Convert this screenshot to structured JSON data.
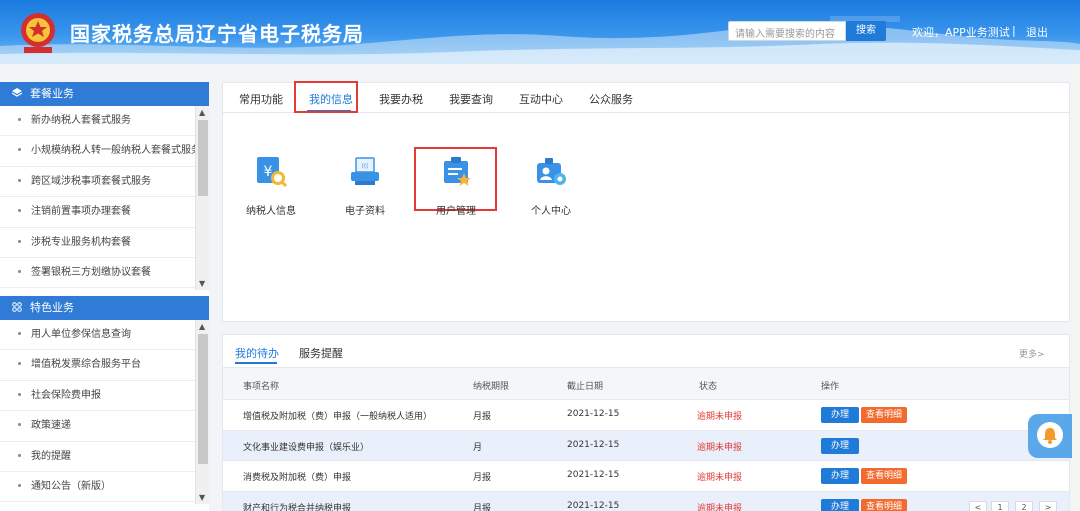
{
  "header": {
    "site_title": "国家税务总局辽宁省电子税务局",
    "search_placeholder": "请输入需要搜索的内容",
    "search_button": "搜索",
    "welcome": "欢迎，APP业务测试",
    "separator": "|",
    "logout": "退出"
  },
  "sidebar": {
    "package_title": "套餐业务",
    "package_items": [
      {
        "label": "新办纳税人套餐式服务"
      },
      {
        "label": "小规模纳税人转一般纳税人套餐式服务"
      },
      {
        "label": "跨区域涉税事项套餐式服务"
      },
      {
        "label": "注销前置事项办理套餐"
      },
      {
        "label": "涉税专业服务机构套餐"
      },
      {
        "label": "签署银税三方划缴协议套餐"
      }
    ],
    "special_title": "特色业务",
    "special_items": [
      {
        "label": "用人单位参保信息查询"
      },
      {
        "label": "增值税发票综合服务平台"
      },
      {
        "label": "社会保险费申报"
      },
      {
        "label": "政策速递"
      },
      {
        "label": "我的提醒"
      },
      {
        "label": "通知公告（新版）"
      }
    ]
  },
  "main_tabs": [
    {
      "label": "常用功能"
    },
    {
      "label": "我的信息"
    },
    {
      "label": "我要办税"
    },
    {
      "label": "我要查询"
    },
    {
      "label": "互动中心"
    },
    {
      "label": "公众服务"
    }
  ],
  "active_tab": "我的信息",
  "functions": [
    {
      "label": "纳税人信息",
      "icon": "taxpayer-info-icon"
    },
    {
      "label": "电子资料",
      "icon": "electronic-docs-icon"
    },
    {
      "label": "用户管理",
      "icon": "user-management-icon"
    },
    {
      "label": "个人中心",
      "icon": "personal-center-icon"
    }
  ],
  "todo": {
    "tabs": [
      {
        "label": "我的待办"
      },
      {
        "label": "服务提醒"
      }
    ],
    "more": "更多>",
    "headers": {
      "name": "事项名称",
      "period": "纳税期限",
      "deadline": "截止日期",
      "status": "状态",
      "action": "操作"
    },
    "rows": [
      {
        "name": "增值税及附加税（费）申报（一般纳税人适用）",
        "period": "月报",
        "deadline": "2021-12-15",
        "status": "逾期未申报",
        "do": "办理",
        "detail": "查看明细"
      },
      {
        "name": "文化事业建设费申报（娱乐业）",
        "period": "月",
        "deadline": "2021-12-15",
        "status": "逾期未申报",
        "do": "办理",
        "detail": ""
      },
      {
        "name": "消费税及附加税（费）申报",
        "period": "月报",
        "deadline": "2021-12-15",
        "status": "逾期未申报",
        "do": "办理",
        "detail": "查看明细"
      },
      {
        "name": "财产和行为税合并纳税申报",
        "period": "月报",
        "deadline": "2021-12-15",
        "status": "逾期未申报",
        "do": "办理",
        "detail": "查看明细"
      }
    ],
    "pager": {
      "prev": "<",
      "pages": [
        "1",
        "2"
      ],
      "next": ">"
    }
  },
  "colors": {
    "primary": "#1f7ad8",
    "sidebar_head": "#2f7bd5",
    "alert_red": "#e53935",
    "detail_orange": "#f26a2e"
  }
}
